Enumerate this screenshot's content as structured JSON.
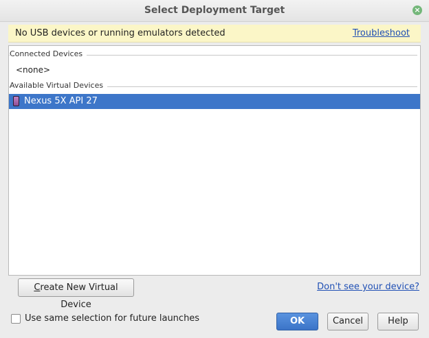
{
  "window": {
    "title": "Select Deployment Target",
    "close_glyph": "×"
  },
  "banner": {
    "message": "No USB devices or running emulators detected",
    "troubleshoot_link": "Troubleshoot"
  },
  "device_list": {
    "connected_header": "Connected Devices",
    "connected_empty": "<none>",
    "virtual_header": "Available Virtual Devices",
    "virtual_devices": [
      {
        "name": "Nexus 5X API 27",
        "icon": "phone-icon",
        "selected": true
      }
    ]
  },
  "actions": {
    "create_button_mnemonic": "C",
    "create_button_rest": "reate New Virtual Device",
    "dont_see_link": "Don't see your device?"
  },
  "footer": {
    "checkbox_label": "Use same selection for future launches",
    "checkbox_checked": false,
    "ok_label": "OK",
    "cancel_label": "Cancel",
    "help_label": "Help"
  },
  "colors": {
    "selection": "#3d76c9",
    "banner_bg": "#fbf6c7",
    "link": "#1f4fb4",
    "primary_button": "#3b74c8"
  }
}
